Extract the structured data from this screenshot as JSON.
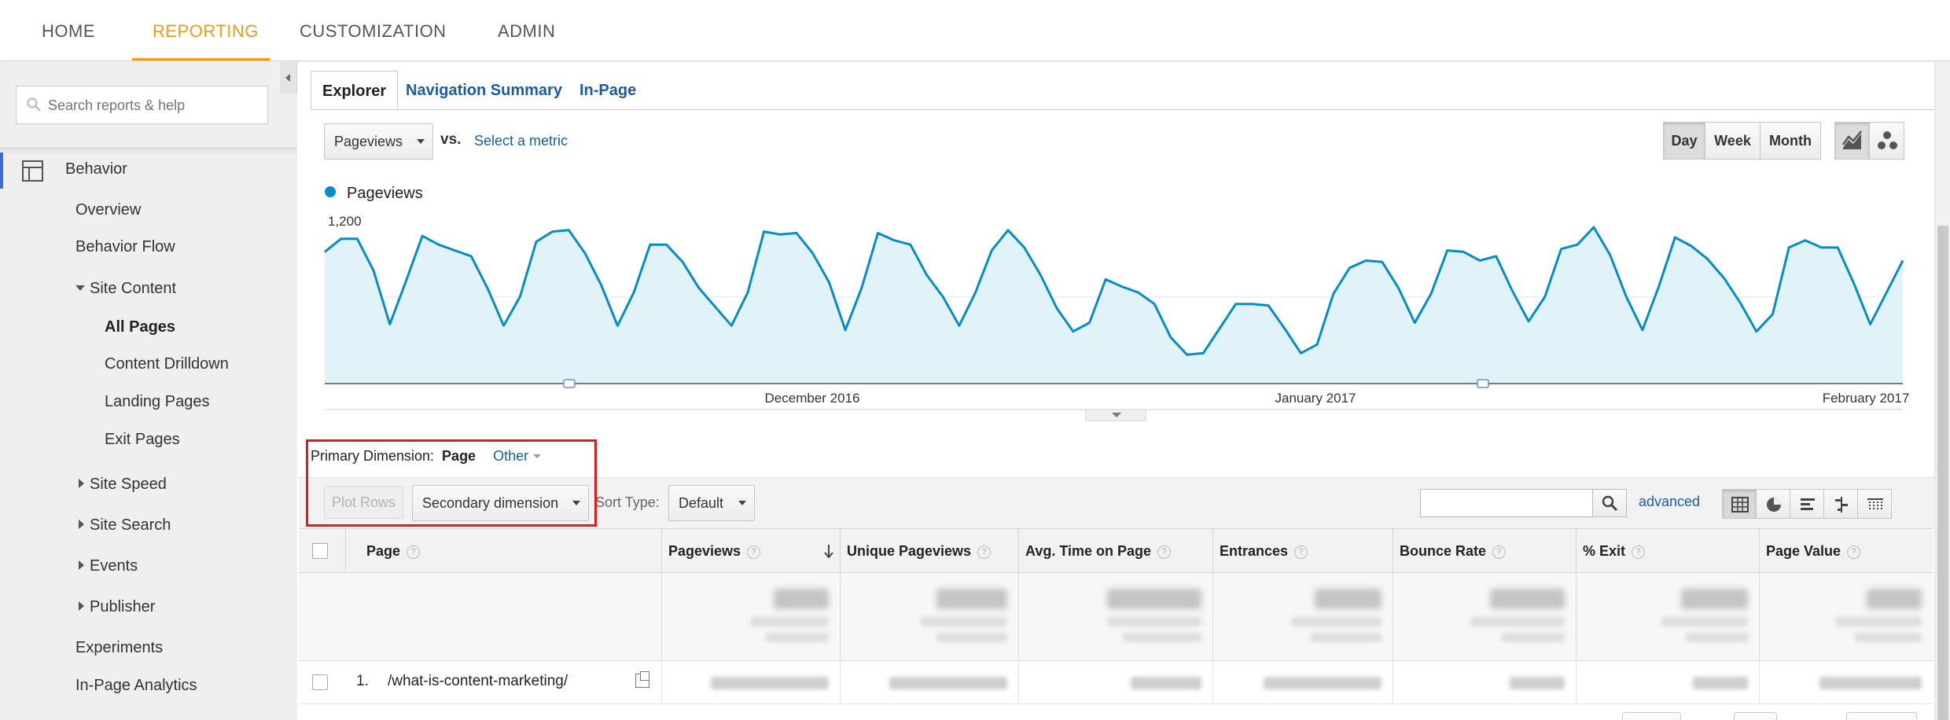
{
  "topnav": {
    "tabs": [
      {
        "label": "HOME",
        "active": false
      },
      {
        "label": "REPORTING",
        "active": true
      },
      {
        "label": "CUSTOMIZATION",
        "active": false
      },
      {
        "label": "ADMIN",
        "active": false
      }
    ],
    "accent_color": "#f29a18"
  },
  "sidebar": {
    "search_placeholder": "Search reports & help",
    "section_label": "Behavior",
    "items": {
      "overview": "Overview",
      "behavior_flow": "Behavior Flow",
      "site_content": "Site Content",
      "all_pages": "All Pages",
      "content_drilldown": "Content Drilldown",
      "landing_pages": "Landing Pages",
      "exit_pages": "Exit Pages",
      "site_speed": "Site Speed",
      "site_search": "Site Search",
      "events": "Events",
      "publisher": "Publisher",
      "experiments": "Experiments",
      "in_page_analytics": "In-Page Analytics"
    }
  },
  "report_tabs": [
    {
      "label": "Explorer",
      "active": true
    },
    {
      "label": "Navigation Summary",
      "active": false
    },
    {
      "label": "In-Page",
      "active": false
    }
  ],
  "controls": {
    "metric": "Pageviews",
    "vs": "vs.",
    "select_metric": "Select a metric",
    "granularity": [
      {
        "label": "Day",
        "active": true
      },
      {
        "label": "Week",
        "active": false
      },
      {
        "label": "Month",
        "active": false
      }
    ]
  },
  "chart_data": {
    "type": "area",
    "legend": "Pageviews",
    "series_color": "#058dc7",
    "fill_color": "#e1f2f8",
    "y_ticks": [
      "1,200",
      "600"
    ],
    "ylim": [
      0,
      1200
    ],
    "x_labels": [
      "December 2016",
      "January 2017",
      "February 2017"
    ],
    "grid": true,
    "values": [
      910,
      1000,
      1000,
      780,
      410,
      710,
      1020,
      960,
      920,
      880,
      660,
      400,
      600,
      980,
      1050,
      1060,
      900,
      680,
      400,
      630,
      960,
      960,
      840,
      660,
      530,
      400,
      630,
      1050,
      1030,
      1040,
      900,
      700,
      370,
      660,
      1040,
      990,
      960,
      750,
      600,
      400,
      630,
      920,
      1060,
      940,
      750,
      520,
      360,
      420,
      720,
      670,
      630,
      550,
      320,
      200,
      210,
      380,
      550,
      550,
      540,
      380,
      210,
      270,
      620,
      800,
      850,
      840,
      660,
      420,
      620,
      920,
      910,
      850,
      880,
      640,
      430,
      600,
      930,
      960,
      1080,
      890,
      600,
      370,
      670,
      1010,
      950,
      860,
      730,
      560,
      360,
      480,
      940,
      990,
      940,
      940,
      690,
      410,
      630,
      850
    ]
  },
  "dimension": {
    "label": "Primary Dimension:",
    "value": "Page",
    "other": "Other"
  },
  "toolbar": {
    "plot_rows": "Plot Rows",
    "secondary_dimension": "Secondary dimension",
    "sort_type_label": "Sort Type:",
    "sort_type_value": "Default",
    "advanced": "advanced"
  },
  "table": {
    "columns": [
      "Page",
      "Pageviews",
      "Unique Pageviews",
      "Avg. Time on Page",
      "Entrances",
      "Bounce Rate",
      "% Exit",
      "Page Value"
    ],
    "help_glyph": "?",
    "rows": [
      {
        "num": "1.",
        "page": "/what-is-content-marketing/"
      }
    ]
  }
}
